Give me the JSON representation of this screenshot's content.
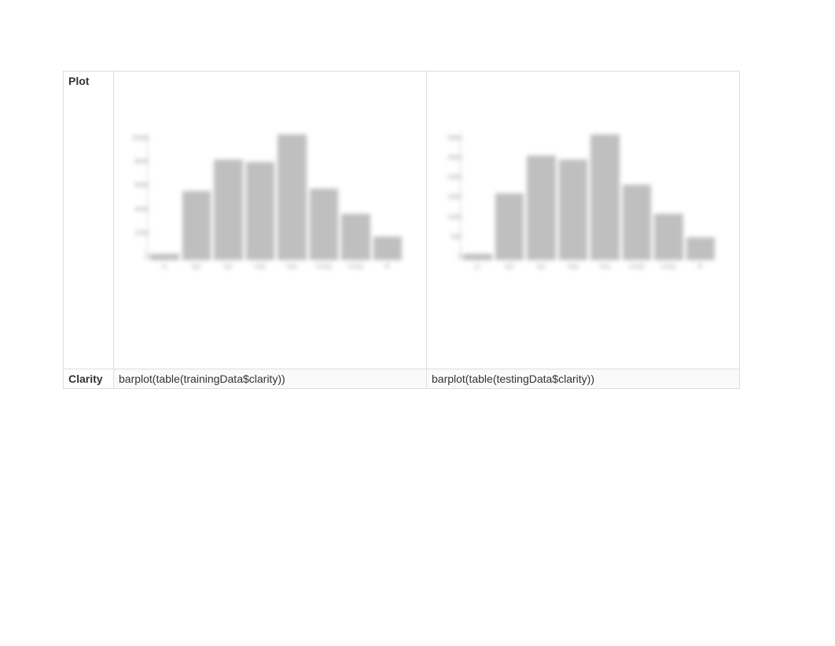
{
  "row_headers": {
    "plot": "Plot",
    "clarity": "Clarity"
  },
  "cells": {
    "left_code": "barplot(table(trainingData$clarity))",
    "right_code": "barplot(table(testingData$clarity))"
  },
  "chart_data": [
    {
      "type": "bar",
      "title": "",
      "xlabel": "",
      "ylabel": "",
      "categories": [
        "I1",
        "SI2",
        "SI1",
        "VS2",
        "VS1",
        "VVS2",
        "VVS1",
        "IF"
      ],
      "values": [
        500,
        5500,
        8000,
        7800,
        10000,
        5700,
        3700,
        1900
      ],
      "ylim": [
        0,
        10000
      ],
      "y_ticks": [
        0,
        2000,
        4000,
        6000,
        8000,
        10000
      ]
    },
    {
      "type": "bar",
      "title": "",
      "xlabel": "",
      "ylabel": "",
      "categories": [
        "I1",
        "SI2",
        "SI1",
        "VS2",
        "VS1",
        "VVS2",
        "VVS1",
        "IF"
      ],
      "values": [
        150,
        1600,
        2500,
        2400,
        3000,
        1800,
        1100,
        550
      ],
      "ylim": [
        0,
        3000
      ],
      "y_ticks": [
        0,
        500,
        1000,
        1500,
        2000,
        2500,
        3000
      ]
    }
  ]
}
